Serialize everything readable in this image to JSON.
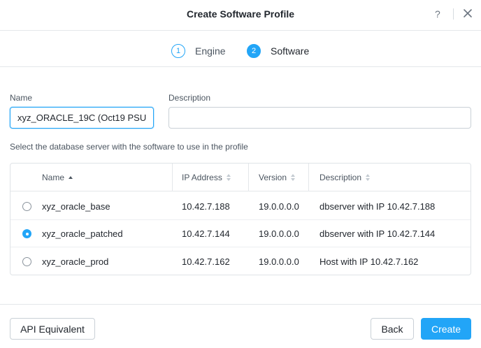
{
  "dialog": {
    "title": "Create Software Profile",
    "help_label": "?"
  },
  "wizard": {
    "steps": [
      {
        "number": "1",
        "label": "Engine",
        "state": "inactive"
      },
      {
        "number": "2",
        "label": "Software",
        "state": "active"
      }
    ]
  },
  "form": {
    "name_label": "Name",
    "name_value": "xyz_ORACLE_19C (Oct19 PSU)",
    "description_label": "Description",
    "description_value": "",
    "select_hint": "Select the database server with the software to use in the profile"
  },
  "table": {
    "columns": [
      {
        "label": "Name",
        "sort": "asc"
      },
      {
        "label": "IP Address",
        "sort": "none"
      },
      {
        "label": "Version",
        "sort": "none"
      },
      {
        "label": "Description",
        "sort": "none"
      }
    ],
    "rows": [
      {
        "selected": false,
        "name": "xyz_oracle_base",
        "ip": "10.42.7.188",
        "version": "19.0.0.0.0",
        "description": "dbserver with IP 10.42.7.188"
      },
      {
        "selected": true,
        "name": "xyz_oracle_patched",
        "ip": "10.42.7.144",
        "version": "19.0.0.0.0",
        "description": "dbserver with IP 10.42.7.144"
      },
      {
        "selected": false,
        "name": "xyz_oracle_prod",
        "ip": "10.42.7.162",
        "version": "19.0.0.0.0",
        "description": "Host with IP 10.42.7.162"
      }
    ]
  },
  "footer": {
    "api_label": "API Equivalent",
    "back_label": "Back",
    "create_label": "Create"
  },
  "colors": {
    "accent": "#22a5f7",
    "text": "#22272e",
    "muted": "#4b5560",
    "border": "#e4e7ea"
  }
}
